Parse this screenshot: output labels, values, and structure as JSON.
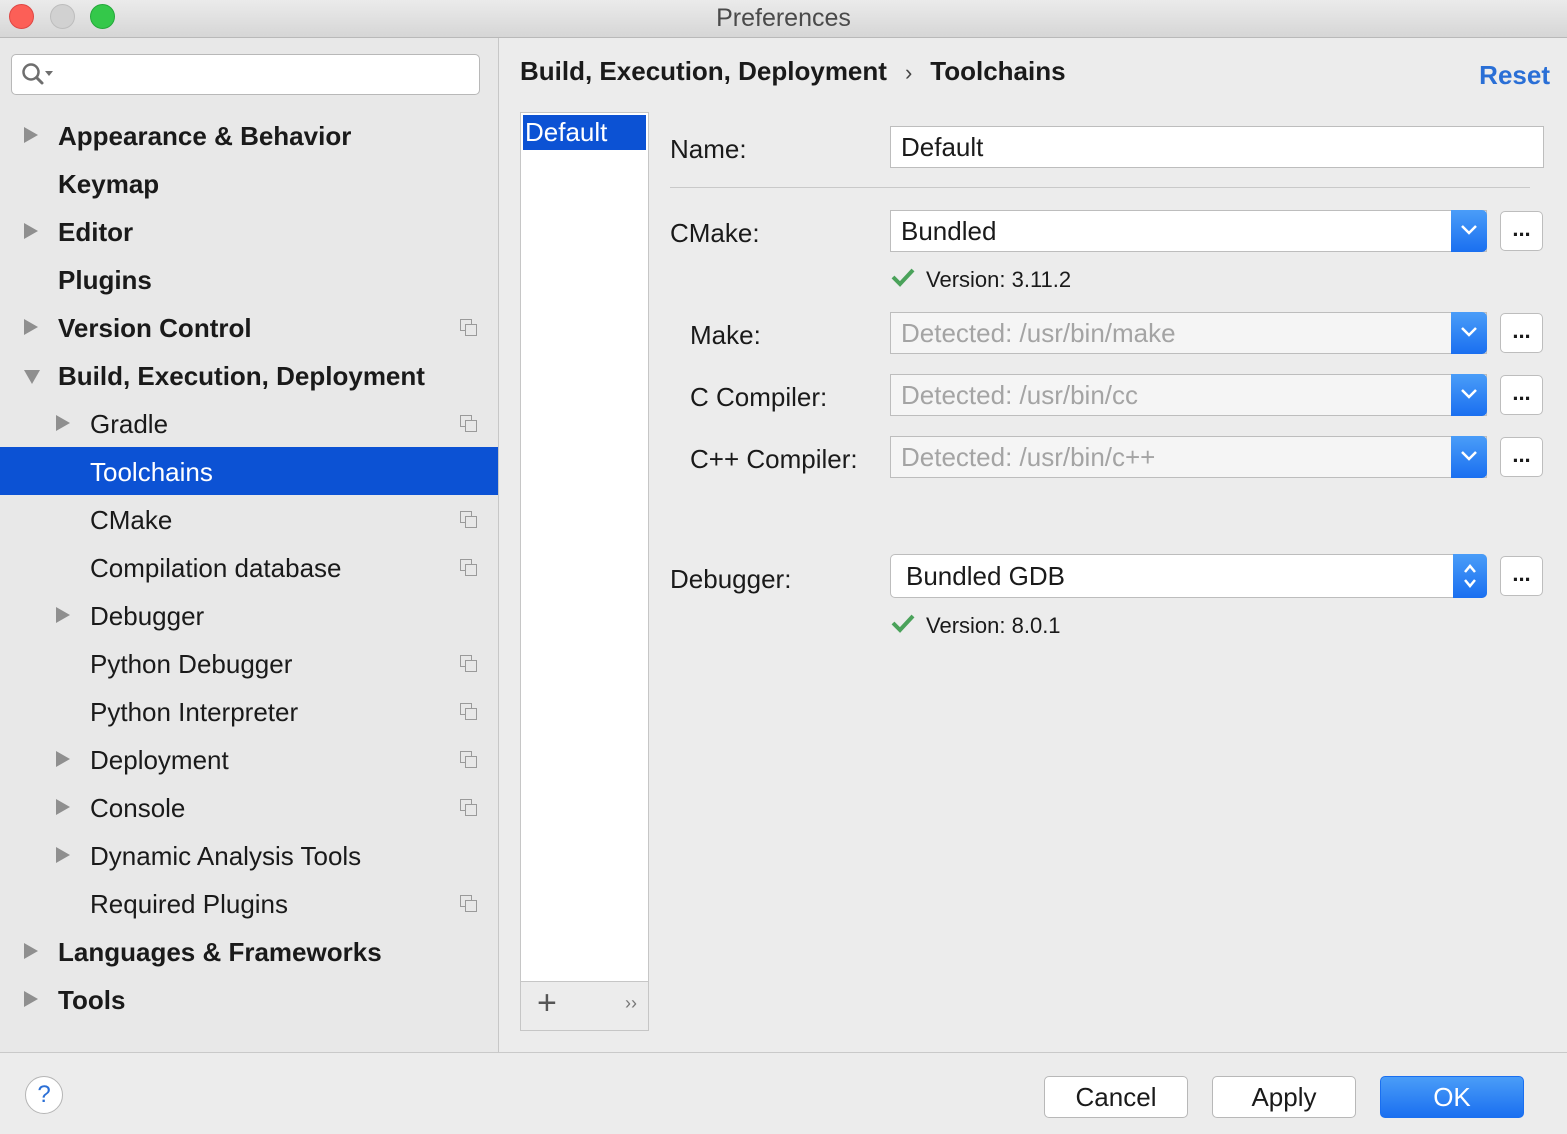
{
  "window": {
    "title": "Preferences"
  },
  "sidebar": {
    "search": {
      "value": "",
      "placeholder": ""
    },
    "items": [
      {
        "label": "Appearance & Behavior",
        "expanded": false
      },
      {
        "label": "Keymap"
      },
      {
        "label": "Editor",
        "expanded": false
      },
      {
        "label": "Plugins"
      },
      {
        "label": "Version Control",
        "expanded": false
      },
      {
        "label": "Build, Execution, Deployment",
        "expanded": true
      },
      {
        "label": "Gradle",
        "expanded": false
      },
      {
        "label": "Toolchains",
        "selected": true
      },
      {
        "label": "CMake"
      },
      {
        "label": "Compilation database"
      },
      {
        "label": "Debugger",
        "expanded": false
      },
      {
        "label": "Python Debugger"
      },
      {
        "label": "Python Interpreter"
      },
      {
        "label": "Deployment",
        "expanded": false
      },
      {
        "label": "Console",
        "expanded": false
      },
      {
        "label": "Dynamic Analysis Tools",
        "expanded": false
      },
      {
        "label": "Required Plugins"
      },
      {
        "label": "Languages & Frameworks",
        "expanded": false
      },
      {
        "label": "Tools",
        "expanded": false
      }
    ]
  },
  "header": {
    "breadcrumb_parent": "Build, Execution, Deployment",
    "breadcrumb_sep": "›",
    "breadcrumb_current": "Toolchains",
    "reset": "Reset"
  },
  "toolchains": {
    "items": [
      "Default"
    ],
    "add": "+",
    "more": "››"
  },
  "form": {
    "name_label": "Name:",
    "name_value": "Default",
    "cmake_label": "CMake:",
    "cmake_value": "Bundled",
    "cmake_version": "Version: 3.11.2",
    "make_label": "Make:",
    "make_value": "Detected: /usr/bin/make",
    "c_label": "C Compiler:",
    "c_value": "Detected: /usr/bin/cc",
    "cpp_label": "C++ Compiler:",
    "cpp_value": "Detected: /usr/bin/c++",
    "debugger_label": "Debugger:",
    "debugger_value": "Bundled GDB",
    "debugger_version": "Version: 8.0.1",
    "browse": "..."
  },
  "footer": {
    "help": "?",
    "cancel": "Cancel",
    "apply": "Apply",
    "ok": "OK"
  },
  "colors": {
    "accent": "#0c52d4",
    "link": "#2a6fd6",
    "check": "#4aa25a"
  }
}
